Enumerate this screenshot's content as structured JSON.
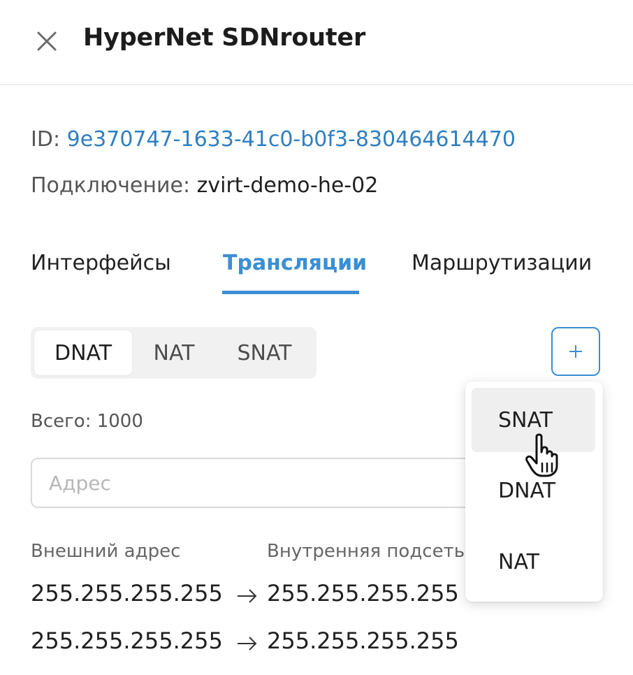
{
  "header": {
    "title": "HyperNet SDNrouter",
    "close_icon": "close-icon"
  },
  "info": {
    "id_label": "ID:",
    "id_value": "9e370747-1633-41c0-b0f3-830464614470",
    "connection_label": "Подключение:",
    "connection_value": "zvirt-demo-he-02"
  },
  "tabs": [
    {
      "label": "Интерфейсы",
      "active": false
    },
    {
      "label": "Трансляции",
      "active": true
    },
    {
      "label": "Маршрутизации",
      "active": false
    }
  ],
  "segmented": {
    "options": [
      "DNAT",
      "NAT",
      "SNAT"
    ],
    "selected": "DNAT"
  },
  "add_button": {
    "icon": "plus-icon",
    "label": "+"
  },
  "total_text": "Всего: 1000",
  "search": {
    "placeholder": "Адрес",
    "value": ""
  },
  "table": {
    "columns": [
      "Внешний адрес",
      "Внутренняя подсеть"
    ],
    "rows": [
      {
        "external": "255.255.255.255",
        "internal": "255.255.255.255"
      },
      {
        "external": "255.255.255.255",
        "internal": "255.255.255.255"
      }
    ],
    "arrow_icon": "arrow-right-icon"
  },
  "dropdown": {
    "items": [
      "SNAT",
      "DNAT",
      "NAT"
    ],
    "hovered": "SNAT"
  },
  "colors": {
    "accent": "#3a8fd4",
    "link": "#2f7fc1",
    "text": "#1f1f1f",
    "muted": "#565656"
  }
}
